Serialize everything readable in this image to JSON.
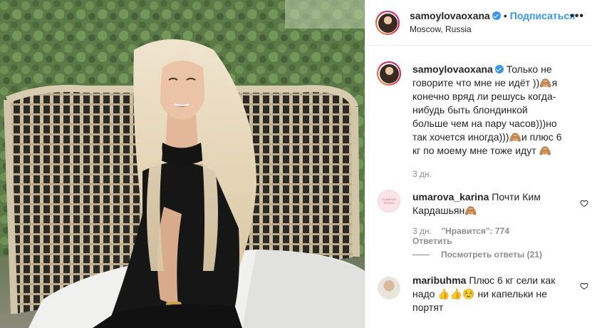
{
  "header": {
    "username": "samoylovaoxana",
    "dot": "•",
    "follow_label": "Подписаться",
    "location": "Moscow, Russia",
    "more_icon": "more-dots-icon"
  },
  "caption": {
    "username": "samoylovaoxana",
    "text": "Только не говорите что мне не идёт ))🙈я конечно вряд ли решусь когда-нибудь быть блондинкой больше чем на пару часов)))но так хочется иногда)))🙈и плюс 6 кг по моему мне тоже идут 🙈",
    "time": "3 дн."
  },
  "comments": [
    {
      "username": "umarova_karina",
      "text": "Почти Ким Кардашьян🙈",
      "time": "3 дн.",
      "likes": "\"Нравится\": 774",
      "reply_label": "Ответить",
      "view_replies": "Посмотреть ответы (21)",
      "avatar_text": "GLAMOUR STUDIO"
    },
    {
      "username": "maribuhma",
      "text": "Плюс 6 кг сели как надо 👍👍☺️ ни капельки не портят"
    }
  ],
  "colors": {
    "accent": "#3897f0",
    "muted": "#8e8e8e",
    "text": "#262626"
  }
}
